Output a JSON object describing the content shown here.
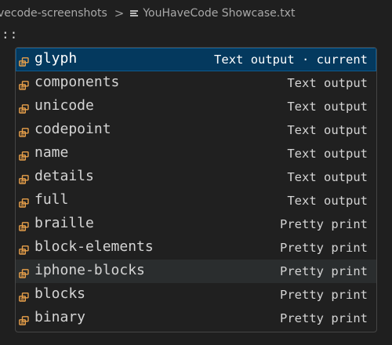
{
  "breadcrumb": {
    "folder": "vecode-screenshots",
    "separator": ">",
    "file": "YouHaveCode Showcase.txt"
  },
  "editor": {
    "line_text": "::"
  },
  "suggest": {
    "items": [
      {
        "label": "glyph",
        "detail": "Text output · current",
        "icon": "snippet-icon",
        "state": "selected"
      },
      {
        "label": "components",
        "detail": "Text output",
        "icon": "snippet-icon",
        "state": ""
      },
      {
        "label": "unicode",
        "detail": "Text output",
        "icon": "snippet-icon",
        "state": ""
      },
      {
        "label": "codepoint",
        "detail": "Text output",
        "icon": "snippet-icon",
        "state": ""
      },
      {
        "label": "name",
        "detail": "Text output",
        "icon": "snippet-icon",
        "state": ""
      },
      {
        "label": "details",
        "detail": "Text output",
        "icon": "snippet-icon",
        "state": ""
      },
      {
        "label": "full",
        "detail": "Text output",
        "icon": "snippet-icon",
        "state": ""
      },
      {
        "label": "braille",
        "detail": "Pretty print",
        "icon": "snippet-icon",
        "state": ""
      },
      {
        "label": "block-elements",
        "detail": "Pretty print",
        "icon": "snippet-icon",
        "state": ""
      },
      {
        "label": "iphone-blocks",
        "detail": "Pretty print",
        "icon": "snippet-icon",
        "state": "hovered"
      },
      {
        "label": "blocks",
        "detail": "Pretty print",
        "icon": "snippet-icon",
        "state": ""
      },
      {
        "label": "binary",
        "detail": "Pretty print",
        "icon": "snippet-icon",
        "state": ""
      }
    ]
  },
  "colors": {
    "background": "#1f1f1f",
    "selected_row": "#04395e",
    "icon_orange": "#e8a04a",
    "text": "#d4d4d4"
  }
}
